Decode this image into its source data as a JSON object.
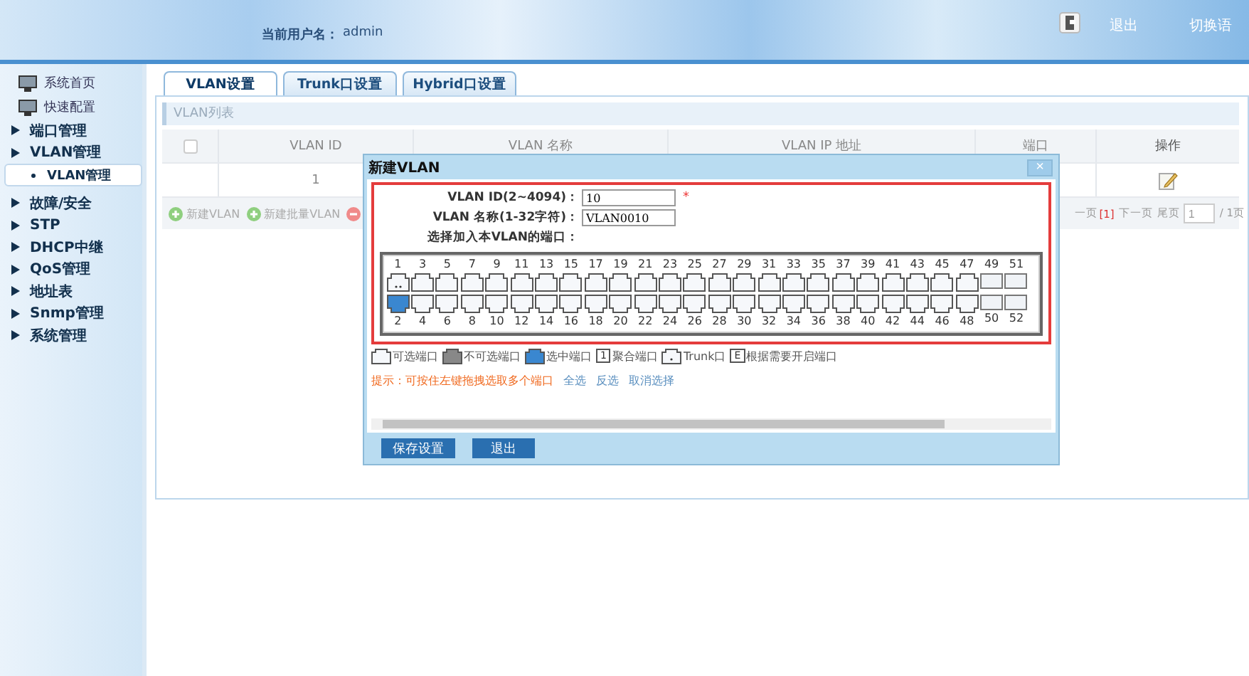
{
  "header": {
    "user_label": "当前用户名：",
    "user": "admin",
    "logout": "退出",
    "language": "切换语"
  },
  "sidebar": {
    "items": [
      {
        "kind": "icon",
        "label": "系统首页"
      },
      {
        "kind": "icon",
        "label": "快速配置"
      },
      {
        "kind": "menu",
        "label": "端口管理"
      },
      {
        "kind": "menu",
        "label": "VLAN管理",
        "children": [
          {
            "label": "VLAN管理",
            "selected": true
          }
        ]
      },
      {
        "kind": "menu",
        "label": "故障/安全"
      },
      {
        "kind": "menu",
        "label": "STP"
      },
      {
        "kind": "menu",
        "label": "DHCP中继"
      },
      {
        "kind": "menu",
        "label": "QoS管理"
      },
      {
        "kind": "menu",
        "label": "地址表"
      },
      {
        "kind": "menu",
        "label": "Snmp管理"
      },
      {
        "kind": "menu",
        "label": "系统管理"
      }
    ]
  },
  "tabs": [
    {
      "label": "VLAN设置",
      "selected": true
    },
    {
      "label": "Trunk口设置",
      "selected": false
    },
    {
      "label": "Hybrid口设置",
      "selected": false
    }
  ],
  "section_title": "VLAN列表",
  "table": {
    "columns": [
      "VLAN ID",
      "VLAN 名称",
      "VLAN IP 地址",
      "端口",
      "操作"
    ],
    "select_all": {
      "checked": false
    },
    "rows": [
      {
        "vlan_id": "1"
      }
    ]
  },
  "toolbar": [
    "新建VLAN",
    "新建批量VLAN"
  ],
  "pager": {
    "prev": "一页",
    "current": "[1]",
    "next": "下一页",
    "last": "尾页",
    "page": "1",
    "total": "/ 1页"
  },
  "dialog": {
    "title": "新建VLAN",
    "close": "×",
    "fields": [
      {
        "label": "VLAN ID(2~4094)：",
        "value": "10",
        "required": "*"
      },
      {
        "label": "VLAN 名称(1-32字符)：",
        "value": "VLAN0010"
      }
    ],
    "ports_label": "选择加入本VLAN的端口：",
    "ports_top": [
      {
        "label": "1",
        "kind": "trunk",
        "selected": false
      },
      {
        "label": "3",
        "kind": "rj45",
        "selected": false
      },
      {
        "label": "5",
        "kind": "rj45",
        "selected": false
      },
      {
        "label": "7",
        "kind": "rj45",
        "selected": false
      },
      {
        "label": "9",
        "kind": "rj45",
        "selected": false
      },
      {
        "label": "11",
        "kind": "rj45",
        "selected": false
      },
      {
        "label": "13",
        "kind": "rj45",
        "selected": false
      },
      {
        "label": "15",
        "kind": "rj45",
        "selected": false
      },
      {
        "label": "17",
        "kind": "rj45",
        "selected": false
      },
      {
        "label": "19",
        "kind": "rj45",
        "selected": false
      },
      {
        "label": "21",
        "kind": "rj45",
        "selected": false
      },
      {
        "label": "23",
        "kind": "rj45",
        "selected": false
      },
      {
        "label": "25",
        "kind": "rj45",
        "selected": false
      },
      {
        "label": "27",
        "kind": "rj45",
        "selected": false
      },
      {
        "label": "29",
        "kind": "rj45",
        "selected": false
      },
      {
        "label": "31",
        "kind": "rj45",
        "selected": false
      },
      {
        "label": "33",
        "kind": "rj45",
        "selected": false
      },
      {
        "label": "35",
        "kind": "rj45",
        "selected": false
      },
      {
        "label": "37",
        "kind": "rj45",
        "selected": false
      },
      {
        "label": "39",
        "kind": "rj45",
        "selected": false
      },
      {
        "label": "41",
        "kind": "rj45",
        "selected": false
      },
      {
        "label": "43",
        "kind": "rj45",
        "selected": false
      },
      {
        "label": "45",
        "kind": "rj45",
        "selected": false
      },
      {
        "label": "47",
        "kind": "rj45",
        "selected": false
      },
      {
        "label": "49",
        "kind": "sfp",
        "selected": false
      },
      {
        "label": "51",
        "kind": "sfp",
        "selected": false
      }
    ],
    "ports_bottom": [
      {
        "label": "2",
        "kind": "rj45",
        "selected": true
      },
      {
        "label": "4",
        "kind": "rj45",
        "selected": false
      },
      {
        "label": "6",
        "kind": "rj45",
        "selected": false
      },
      {
        "label": "8",
        "kind": "rj45",
        "selected": false
      },
      {
        "label": "10",
        "kind": "rj45",
        "selected": false
      },
      {
        "label": "12",
        "kind": "rj45",
        "selected": false
      },
      {
        "label": "14",
        "kind": "rj45",
        "selected": false
      },
      {
        "label": "16",
        "kind": "rj45",
        "selected": false
      },
      {
        "label": "18",
        "kind": "rj45",
        "selected": false
      },
      {
        "label": "20",
        "kind": "rj45",
        "selected": false
      },
      {
        "label": "22",
        "kind": "rj45",
        "selected": false
      },
      {
        "label": "24",
        "kind": "rj45",
        "selected": false
      },
      {
        "label": "26",
        "kind": "rj45",
        "selected": false
      },
      {
        "label": "28",
        "kind": "rj45",
        "selected": false
      },
      {
        "label": "30",
        "kind": "rj45",
        "selected": false
      },
      {
        "label": "32",
        "kind": "rj45",
        "selected": false
      },
      {
        "label": "34",
        "kind": "rj45",
        "selected": false
      },
      {
        "label": "36",
        "kind": "rj45",
        "selected": false
      },
      {
        "label": "38",
        "kind": "rj45",
        "selected": false
      },
      {
        "label": "40",
        "kind": "rj45",
        "selected": false
      },
      {
        "label": "42",
        "kind": "rj45",
        "selected": false
      },
      {
        "label": "44",
        "kind": "rj45",
        "selected": false
      },
      {
        "label": "46",
        "kind": "rj45",
        "selected": false
      },
      {
        "label": "48",
        "kind": "rj45",
        "selected": false
      },
      {
        "label": "50",
        "kind": "sfp",
        "selected": false
      },
      {
        "label": "52",
        "kind": "sfp",
        "selected": false
      }
    ],
    "legend": [
      {
        "kind": "free",
        "label": "可选端口"
      },
      {
        "kind": "disabled",
        "label": "不可选端口"
      },
      {
        "kind": "selected",
        "label": "选中端口"
      },
      {
        "kind": "lag",
        "mark": "1",
        "label": "聚合端口"
      },
      {
        "kind": "trunk",
        "label": "Trunk口"
      },
      {
        "kind": "lag",
        "mark": "E",
        "label": "根据需要开启端口"
      }
    ],
    "hint": "提示：可按住左键拖拽选取多个端口",
    "links": [
      "全选",
      "反选",
      "取消选择"
    ],
    "buttons": [
      "保存设置",
      "退出"
    ]
  }
}
